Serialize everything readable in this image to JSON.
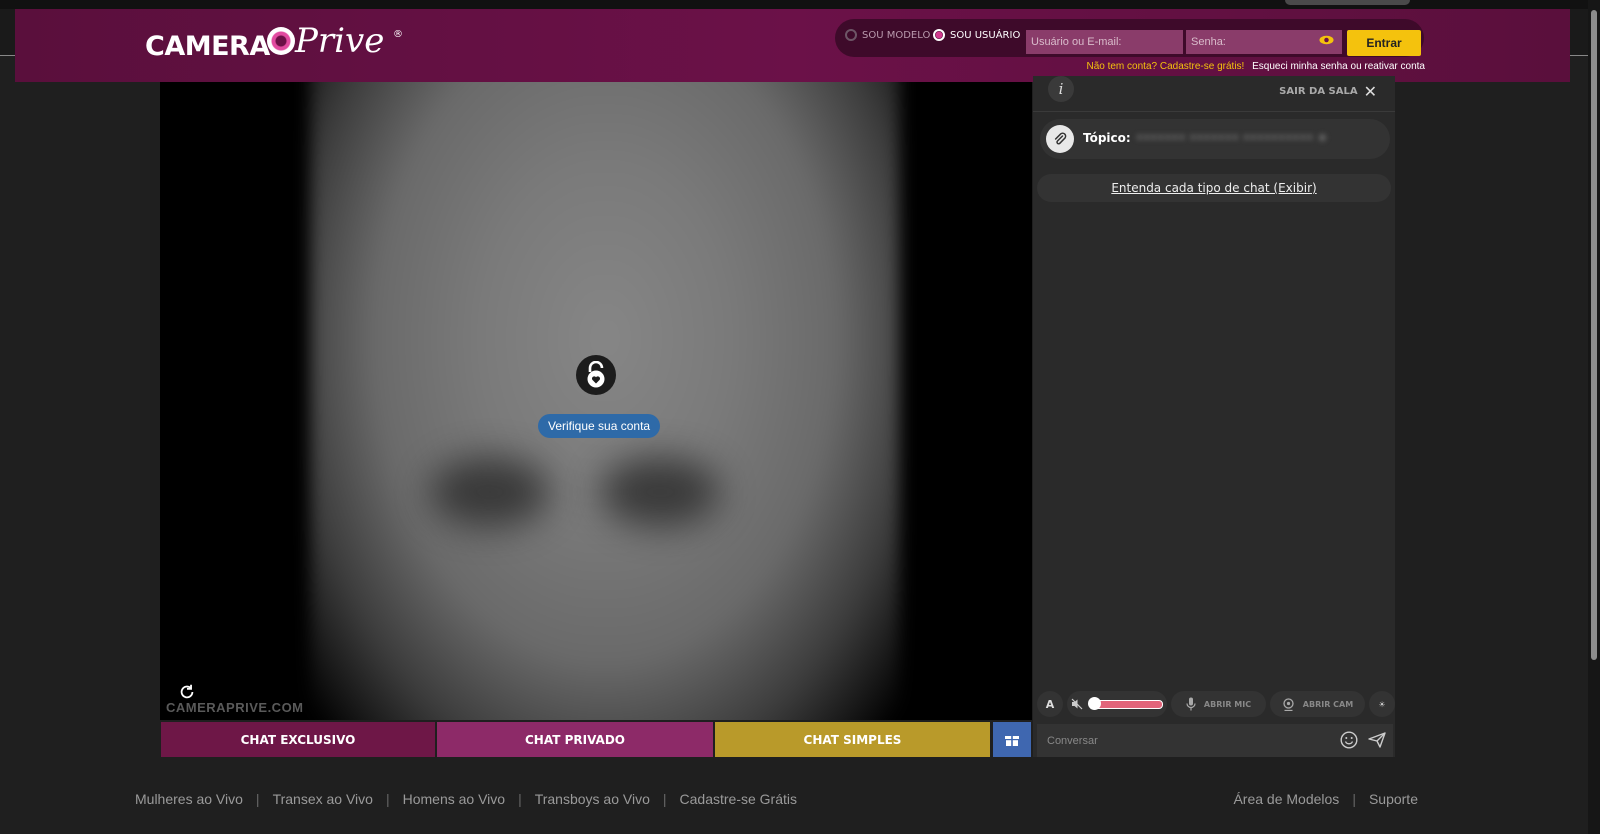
{
  "brand": {
    "camera": "CAMERA",
    "prive": "Prive",
    "reg": "®"
  },
  "login": {
    "model_label": "SOU MODELO",
    "user_label": "SOU USUÁRIO",
    "selected": "SOU USUÁRIO",
    "user_placeholder": "Usuário ou E-mail:",
    "pass_placeholder": "Senha:",
    "enter_label": "Entrar",
    "signup_link": "Não tem conta? Cadastre-se grátis!",
    "forgot_link": "Esqueci minha senha ou reativar conta"
  },
  "video": {
    "verify_label": "Verifique sua conta",
    "watermark": "CAMERAPRIVE.COM",
    "icons": {
      "lock": "lock-heart-icon",
      "reload": "reload-icon"
    }
  },
  "chat_buttons": {
    "exclusive": "CHAT EXCLUSIVO",
    "private": "CHAT PRIVADO",
    "simple": "CHAT SIMPLES",
    "gift_icon": "gift-icon",
    "colors": {
      "exclusive": "#6e1747",
      "private": "#8d2a68",
      "simple": "#b99a2a",
      "gift": "#3f67b0"
    }
  },
  "panel": {
    "info": "i",
    "leave_label": "SAIR DA SALA",
    "topic_label": "Tópico:",
    "topic_value": "[blurred]",
    "chat_types_link": "Entenda cada tipo de chat (Exibir)",
    "font_label": "A",
    "mic_label": "ABRIR MIC",
    "cam_label": "ABRIR CAM",
    "volume_level": 0,
    "message_placeholder": "Conversar"
  },
  "footer": {
    "left_links": [
      "Mulheres ao Vivo",
      "Transex ao Vivo",
      "Homens ao Vivo",
      "Transboys ao Vivo",
      "Cadastre-se Grátis"
    ],
    "right_links": [
      "Área de Modelos",
      "Suporte"
    ]
  },
  "colors": {
    "header": "#6b1148",
    "accent": "#f4c20d",
    "verify": "#2e6aa8"
  }
}
